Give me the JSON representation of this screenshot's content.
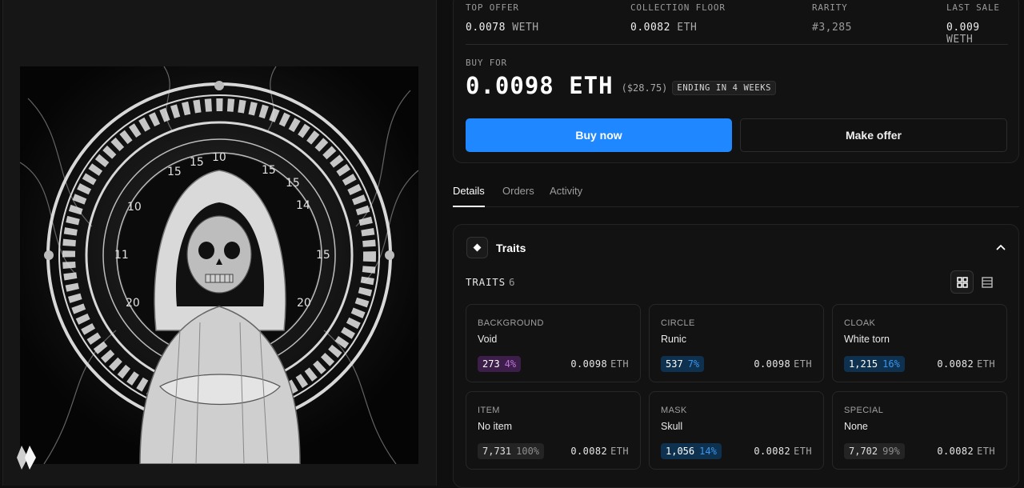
{
  "stats": [
    {
      "label": "TOP OFFER",
      "value": "0.0078",
      "unit": "WETH"
    },
    {
      "label": "COLLECTION FLOOR",
      "value": "0.0082",
      "unit": "ETH"
    },
    {
      "label": "RARITY",
      "value": "#3,285",
      "unit": ""
    },
    {
      "label": "LAST SALE",
      "value": "0.009",
      "unit": "WETH"
    }
  ],
  "purchase": {
    "buy_for_label": "BUY FOR",
    "price": "0.0098 ETH",
    "usd": "($28.75)",
    "ending": "ENDING IN 4 WEEKS",
    "buy_now_label": "Buy now",
    "make_offer_label": "Make offer",
    "accent_color": "#1f87ff"
  },
  "tabs": [
    {
      "label": "Details",
      "active": true
    },
    {
      "label": "Orders",
      "active": false
    },
    {
      "label": "Activity",
      "active": false
    }
  ],
  "traits_panel": {
    "title": "Traits",
    "count_label": "TRAITS",
    "count": "6",
    "icons": {
      "header": "diamond-icon",
      "collapse": "chevron-up-icon",
      "grid": "grid-view-icon",
      "list": "list-view-icon"
    }
  },
  "traits": [
    {
      "type": "BACKGROUND",
      "value": "Void",
      "count": "273",
      "percent": "4%",
      "price": "0.0098",
      "unit": "ETH",
      "badge_color": "#3d1d4a"
    },
    {
      "type": "CIRCLE",
      "value": "Runic",
      "count": "537",
      "percent": "7%",
      "price": "0.0098",
      "unit": "ETH",
      "badge_color": "#0f3150"
    },
    {
      "type": "CLOAK",
      "value": "White torn",
      "count": "1,215",
      "percent": "16%",
      "price": "0.0082",
      "unit": "ETH",
      "badge_color": "#0f3150"
    },
    {
      "type": "ITEM",
      "value": "No item",
      "count": "7,731",
      "percent": "100%",
      "price": "0.0082",
      "unit": "ETH",
      "badge_color": "#242425"
    },
    {
      "type": "MASK",
      "value": "Skull",
      "count": "1,056",
      "percent": "14%",
      "price": "0.0082",
      "unit": "ETH",
      "badge_color": "#0f3150"
    },
    {
      "type": "SPECIAL",
      "value": "None",
      "count": "7,702",
      "percent": "99%",
      "price": "0.0082",
      "unit": "ETH",
      "badge_color": "#242425"
    }
  ],
  "artwork": {
    "ring_numbers": [
      "15",
      "15",
      "10",
      "15",
      "10",
      "15",
      "14",
      "15",
      "11",
      "20",
      "20"
    ]
  }
}
